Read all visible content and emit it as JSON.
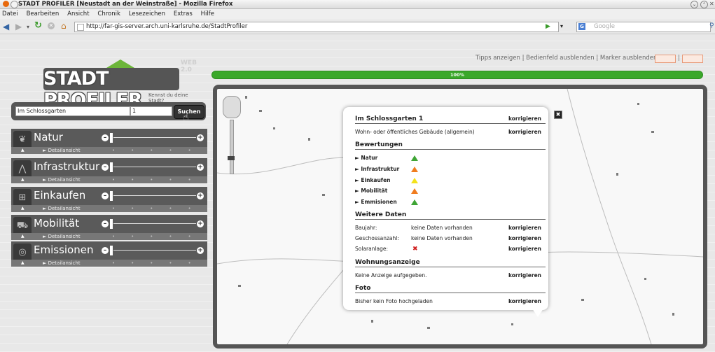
{
  "window": {
    "title": "STADT PROFILER [Neustadt an der Weinstraße] - Mozilla Firefox"
  },
  "menu": [
    "Datei",
    "Bearbeiten",
    "Ansicht",
    "Chronik",
    "Lesezeichen",
    "Extras",
    "Hilfe"
  ],
  "nav": {
    "url": "http://far-gis-server.arch.uni-karlsruhe.de/StadtProfiler",
    "search_placeholder": "Google"
  },
  "toplinks": {
    "text": "Tipps anzeigen | Bedienfeld ausblenden | Marker ausblenden |"
  },
  "progress": {
    "value": 100,
    "label": "100%"
  },
  "logo": {
    "title": "STADT PROFILER",
    "tagline": "Kennst du deine Stadt?",
    "badge": "WEB 2.0"
  },
  "search": {
    "street": "Im Schlossgarten",
    "number": "1",
    "button": "Suchen"
  },
  "categories": [
    {
      "name": "Natur",
      "detail": "► Detailansicht",
      "icon": "leaf-icon"
    },
    {
      "name": "Infrastruktur",
      "detail": "► Detailansicht",
      "icon": "road-icon"
    },
    {
      "name": "Einkaufen",
      "detail": "► Detailansicht",
      "icon": "cart-icon"
    },
    {
      "name": "Mobilität",
      "detail": "► Detailansicht",
      "icon": "car-icon"
    },
    {
      "name": "Emissionen",
      "detail": "► Detailansicht",
      "icon": "ear-icon"
    }
  ],
  "popup": {
    "address": "Im Schlossgarten 1",
    "korrigieren": "korrigieren",
    "building_type": "Wohn- oder öffentliches Gebäude (allgemein)",
    "ratings_header": "Bewertungen",
    "ratings": [
      {
        "label": "► Natur",
        "color": "#3fa535"
      },
      {
        "label": "► Infrastruktur",
        "color": "#f07c1e"
      },
      {
        "label": "► Einkaufen",
        "color": "#f4e21a"
      },
      {
        "label": "► Mobilität",
        "color": "#f07c1e"
      },
      {
        "label": "► Emmisionen",
        "color": "#3fa535"
      }
    ],
    "more_header": "Weitere Daten",
    "baujahr_label": "Baujahr:",
    "baujahr_value": "keine Daten vorhanden",
    "geschoss_label": "Geschossanzahl:",
    "geschoss_value": "keine Daten vorhanden",
    "solar_label": "Solaranlage:",
    "solar_value": "✖",
    "wohnung_header": "Wohnungsanzeige",
    "wohnung_text": "Keine Anzeige aufgegeben.",
    "foto_header": "Foto",
    "foto_text": "Bisher kein Foto hochgeladen",
    "close": "✖"
  }
}
